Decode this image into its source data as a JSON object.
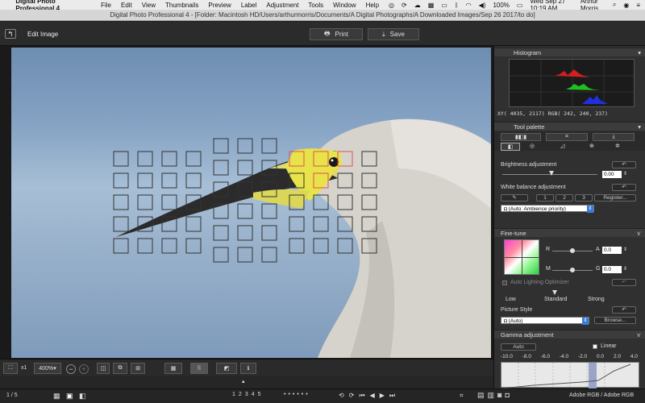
{
  "menubar": {
    "app_name": "Digital Photo Professional 4",
    "items": [
      "File",
      "Edit",
      "View",
      "Thumbnails",
      "Preview",
      "Label",
      "Adjustment",
      "Tools",
      "Window",
      "Help"
    ],
    "battery": "100%",
    "clock": "Wed Sep 27  10:19 AM",
    "user": "Arthur Morris"
  },
  "window": {
    "title": "Digital Photo Professional 4 - [Folder: Macintosh HD/Users/arthurmorris/Documents/A Digital Photographs/A Downloaded Images/Sep 26 2017/to do]"
  },
  "toolbar": {
    "mode_label": "Edit Image",
    "print_label": "Print",
    "save_label": "Save"
  },
  "histogram": {
    "title": "Histogram",
    "readout": "XY(  4035,  2117) RGB( 242, 240, 237)"
  },
  "tool_palette": {
    "title": "Tool palette",
    "brightness_label": "Brightness adjustment",
    "brightness_value": "0.00",
    "brightness_level": 0.0,
    "white_balance_label": "White balance adjustment",
    "wb_presets": [
      "1",
      "2",
      "3"
    ],
    "register_label": "Register...",
    "wb_select_value": "(Auto: Ambience priority)"
  },
  "fine_tune": {
    "title": "Fine-tune",
    "r_label": "R",
    "a_label": "A",
    "a_value": "0.0",
    "m_label": "M",
    "g_label": "G",
    "g_value": "0.0",
    "alo_label": "Auto Lighting Optimizer",
    "low": "Low",
    "standard": "Standard",
    "strong": "Strong",
    "picture_style_label": "Picture Style",
    "picture_style_value": "(Auto)",
    "browse_label": "Browse..."
  },
  "gamma": {
    "title": "Gamma adjustment",
    "auto_label": "Auto",
    "linear_label": "Linear",
    "scale": [
      "-10.0",
      "-8.0",
      "-6.0",
      "-4.0",
      "-2.0",
      "0.0",
      "2.0",
      "4.0"
    ]
  },
  "viewer_controls": {
    "x1": "x1",
    "zoom": "400%"
  },
  "status": {
    "page": "1 / 5",
    "ratings": [
      "1",
      "2",
      "3",
      "4",
      "5"
    ],
    "color_space": "Adobe RGB / Adobe RGB"
  },
  "colors": {
    "accent": "#3a7be0",
    "af_point_active": "#e05050",
    "bill_yellow": "#e8e34a"
  }
}
